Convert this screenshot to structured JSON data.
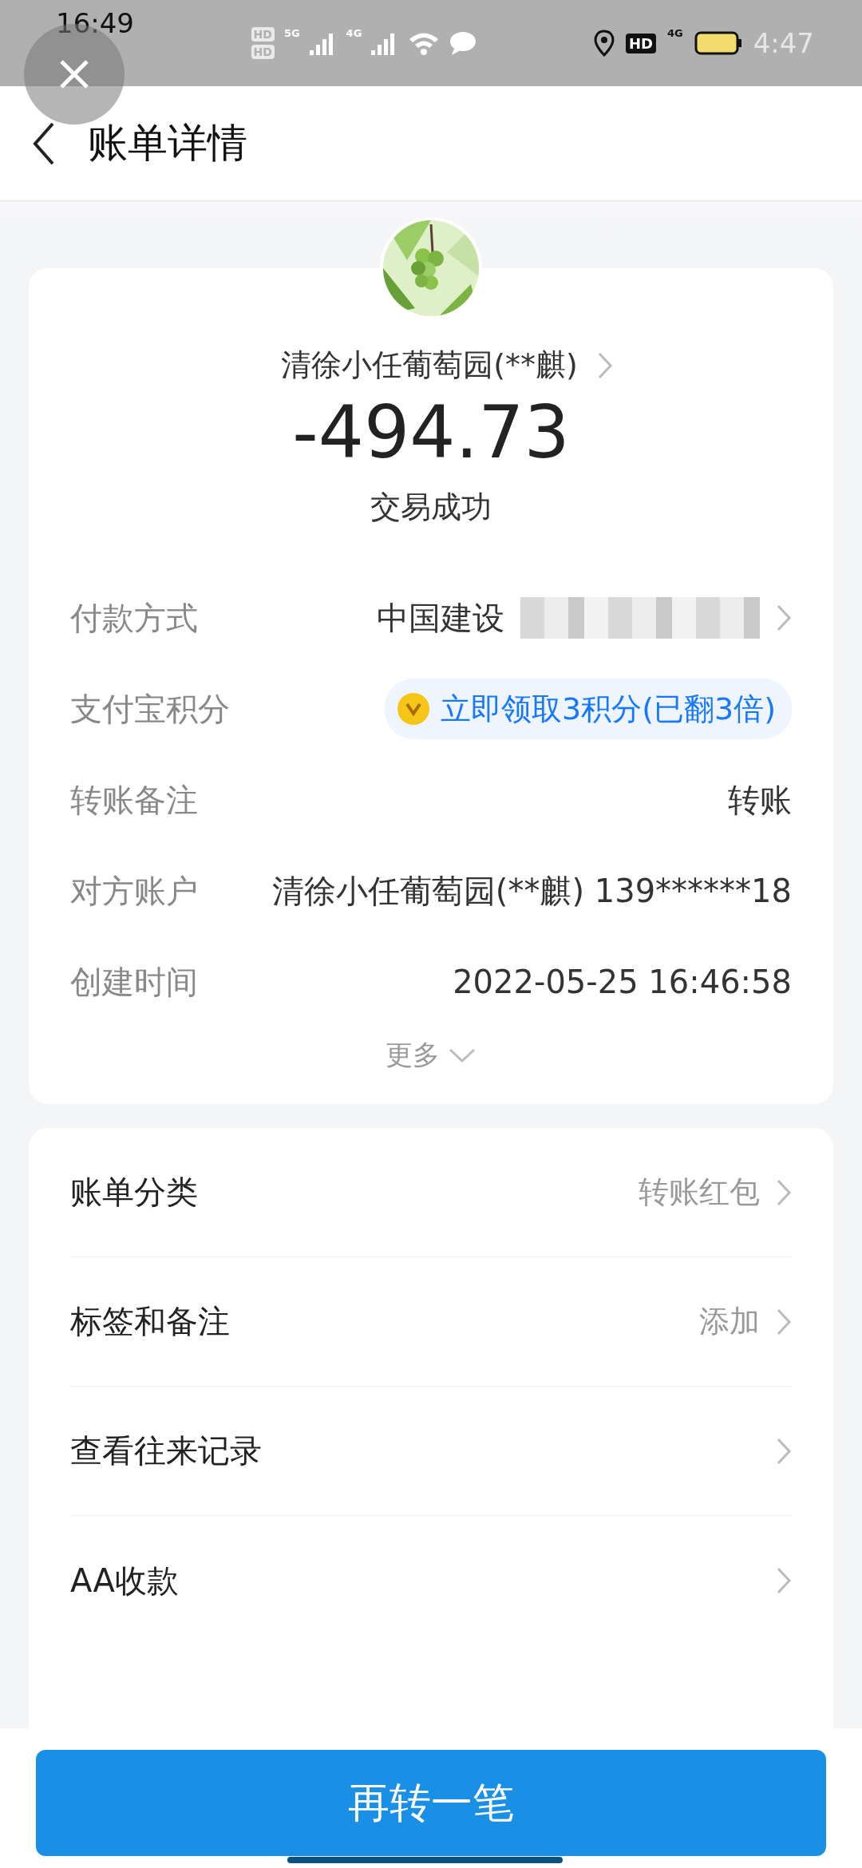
{
  "status_bar": {
    "time": "16:49",
    "overlay_time": "4:47",
    "sim_labels": [
      "HD",
      "HD"
    ],
    "network_labels": [
      "5G",
      "4G"
    ],
    "right_network_label": "4G",
    "right_hd": "HD"
  },
  "header": {
    "title": "账单详情"
  },
  "summary": {
    "payee": "清徐小任葡萄园(**麒)",
    "amount": "-494.73",
    "status": "交易成功"
  },
  "details": [
    {
      "kind": "blurred",
      "label": "付款方式",
      "value": "中国建设"
    },
    {
      "kind": "badge",
      "label": "支付宝积分",
      "value": "立即领取3积分(已翻3倍)"
    },
    {
      "kind": "text",
      "label": "转账备注",
      "value": "转账"
    },
    {
      "kind": "text",
      "label": "对方账户",
      "value": "清徐小任葡萄园(**麒) 139******18"
    },
    {
      "kind": "text",
      "label": "创建时间",
      "value": "2022-05-25 16:46:58"
    }
  ],
  "more": "更多",
  "menu": [
    {
      "label": "账单分类",
      "value": "转账红包"
    },
    {
      "label": "标签和备注",
      "value": "添加"
    },
    {
      "label": "查看往来记录"
    },
    {
      "label": "AA收款"
    }
  ],
  "primary_button": "再转一笔"
}
